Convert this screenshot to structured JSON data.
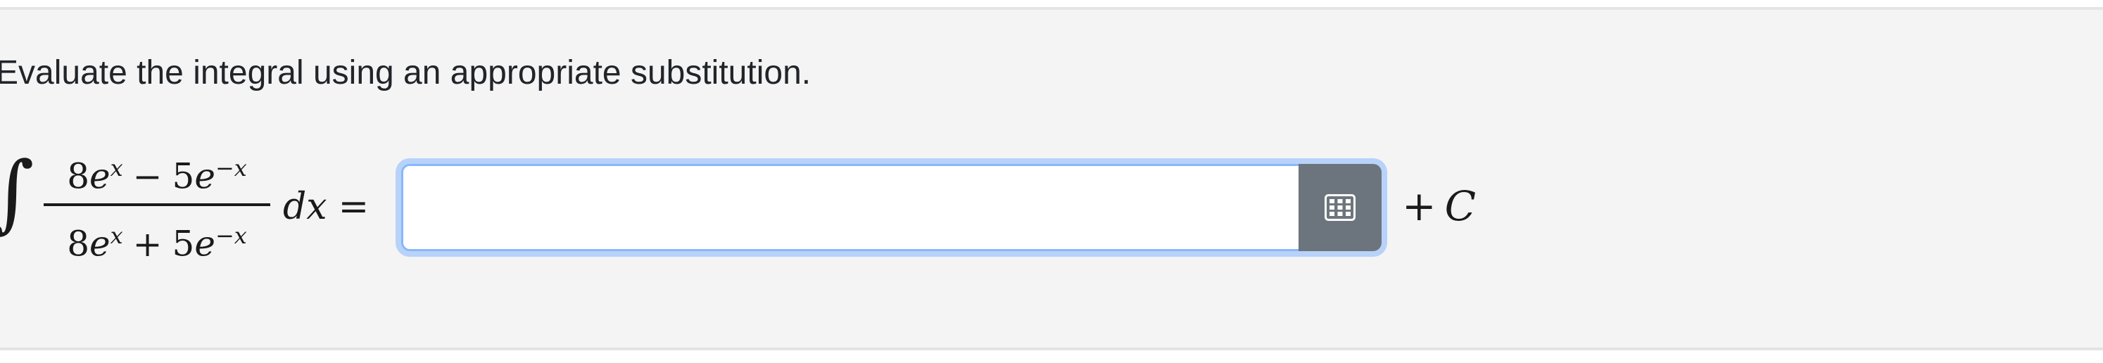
{
  "question": {
    "instruction": "Evaluate the integral using an appropriate substitution."
  },
  "integral": {
    "sign": "∫",
    "numerator": {
      "a": "8",
      "e1": "e",
      "exp1": "x",
      "op": "−",
      "b": "5",
      "e2": "e",
      "exp2": "−x"
    },
    "denominator": {
      "a": "8",
      "e1": "e",
      "exp1": "x",
      "op": "+",
      "b": "5",
      "e2": "e",
      "exp2": "−x"
    },
    "differential": "dx",
    "equals": "="
  },
  "answer": {
    "value": "",
    "placeholder": ""
  },
  "keypad_button": {
    "icon": "keypad-icon"
  },
  "constant": {
    "plus": "+",
    "symbol": "C"
  },
  "colors": {
    "panel_background": "#f4f4f4",
    "focus_border": "#86b7fe",
    "button_background": "#6c757d",
    "text": "#212529"
  }
}
